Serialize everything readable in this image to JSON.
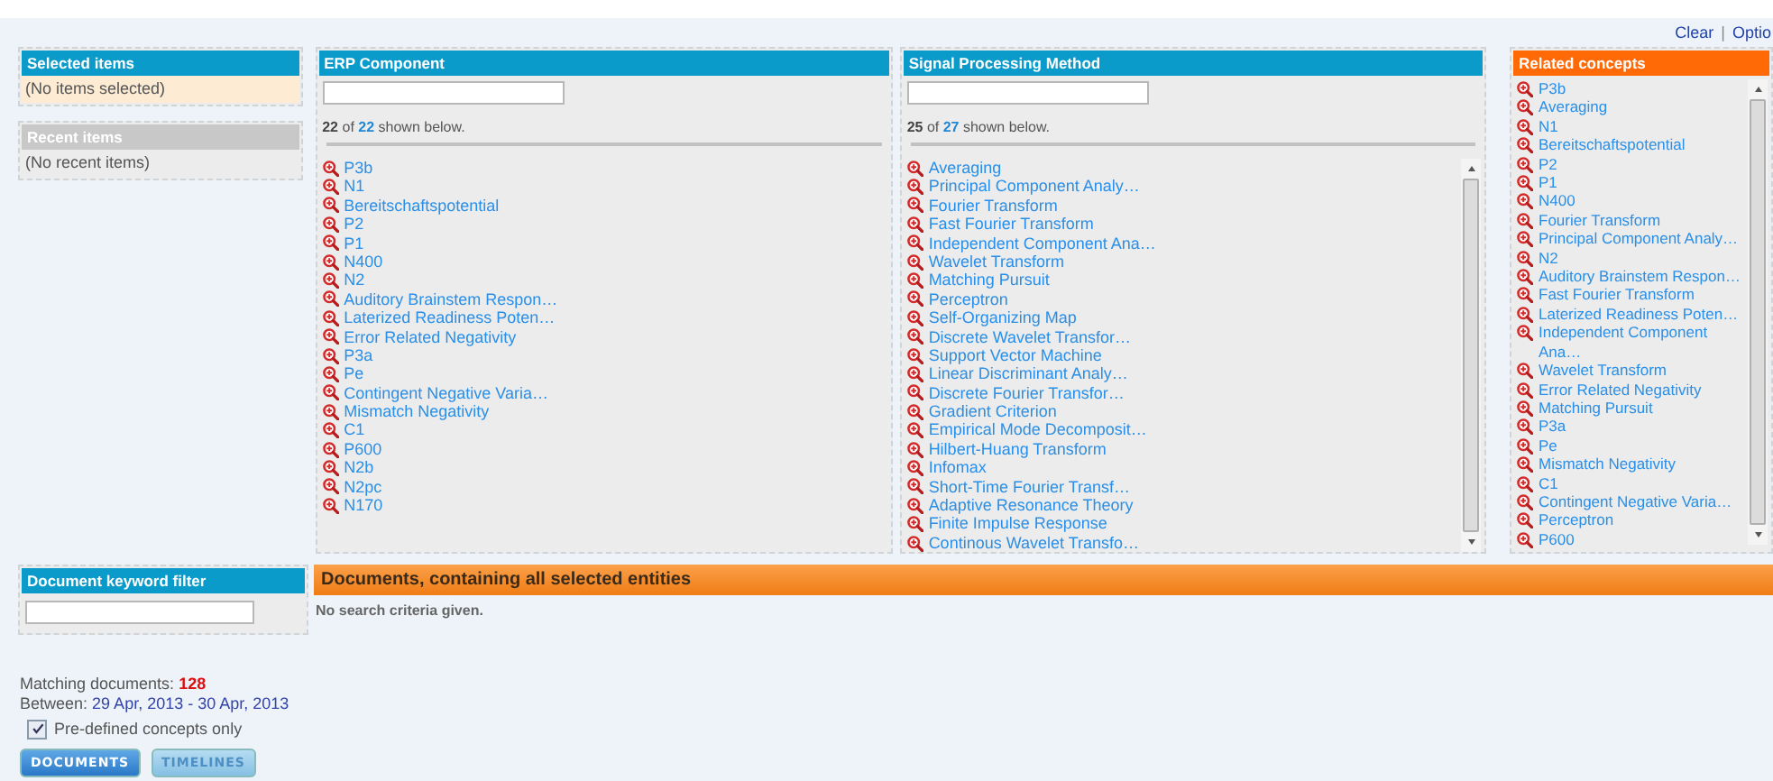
{
  "top_links": {
    "items": [
      {
        "label": "Clear"
      },
      {
        "label": "Optio"
      }
    ],
    "separator": "|"
  },
  "selected_items": {
    "title": "Selected items",
    "empty_text": "(No items selected)"
  },
  "recent_items": {
    "title": "Recent items",
    "empty_text": "(No recent items)"
  },
  "facets": [
    {
      "title": "ERP Component",
      "shown": "22",
      "of": "of",
      "total": "22",
      "suffix": "shown below.",
      "scrollbar": false,
      "items": [
        "P3b",
        "N1",
        "Bereitschaftspotential",
        "P2",
        "P1",
        "N400",
        "N2",
        "Auditory Brainstem Respon…",
        "Laterized Readiness Poten…",
        "Error Related Negativity",
        "P3a",
        "Pe",
        "Contingent Negative Varia…",
        "Mismatch Negativity",
        "C1",
        "P600",
        "N2b",
        "N2pc",
        "N170"
      ]
    },
    {
      "title": "Signal Processing Method",
      "shown": "25",
      "of": "of",
      "total": "27",
      "suffix": "shown below.",
      "scrollbar": true,
      "items": [
        "Averaging",
        "Principal Component Analy…",
        "Fourier Transform",
        "Fast Fourier Transform",
        "Independent Component Ana…",
        "Wavelet Transform",
        "Matching Pursuit",
        "Perceptron",
        "Self-Organizing Map",
        "Discrete Wavelet Transfor…",
        "Support Vector Machine",
        "Linear Discriminant Analy…",
        "Discrete Fourier Transfor…",
        "Gradient Criterion",
        "Empirical Mode Decomposit…",
        "Hilbert-Huang Transform",
        "Infomax",
        "Short-Time Fourier Transf…",
        "Adaptive Resonance Theory",
        "Finite Impulse Response",
        "Continous Wavelet Transfo…"
      ]
    }
  ],
  "related_concepts": {
    "title": "Related concepts",
    "items": [
      "P3b",
      "Averaging",
      "N1",
      "Bereitschaftspotential",
      "P2",
      "P1",
      "N400",
      "Fourier Transform",
      "Principal Component Analy…",
      "N2",
      "Auditory Brainstem Respon…",
      "Fast Fourier Transform",
      "Laterized Readiness Poten…",
      "Independent Component Ana…",
      "Wavelet Transform",
      "Error Related Negativity",
      "Matching Pursuit",
      "P3a",
      "Pe",
      "Mismatch Negativity",
      "C1",
      "Contingent Negative Varia…",
      "Perceptron",
      "P600"
    ]
  },
  "keyword_filter": {
    "title": "Document keyword filter"
  },
  "documents": {
    "title": "Documents, containing all selected entities",
    "message": "No search criteria given."
  },
  "matching": {
    "label": "Matching documents:",
    "count": "128",
    "between_label": "Between:",
    "between_value": "29 Apr, 2013 - 30 Apr, 2013"
  },
  "predefined": {
    "label": "Pre-defined concepts only",
    "checked": true
  },
  "buttons": [
    {
      "label": "DOCUMENTS",
      "disabled": false
    },
    {
      "label": "TIMELINES",
      "disabled": true
    }
  ]
}
